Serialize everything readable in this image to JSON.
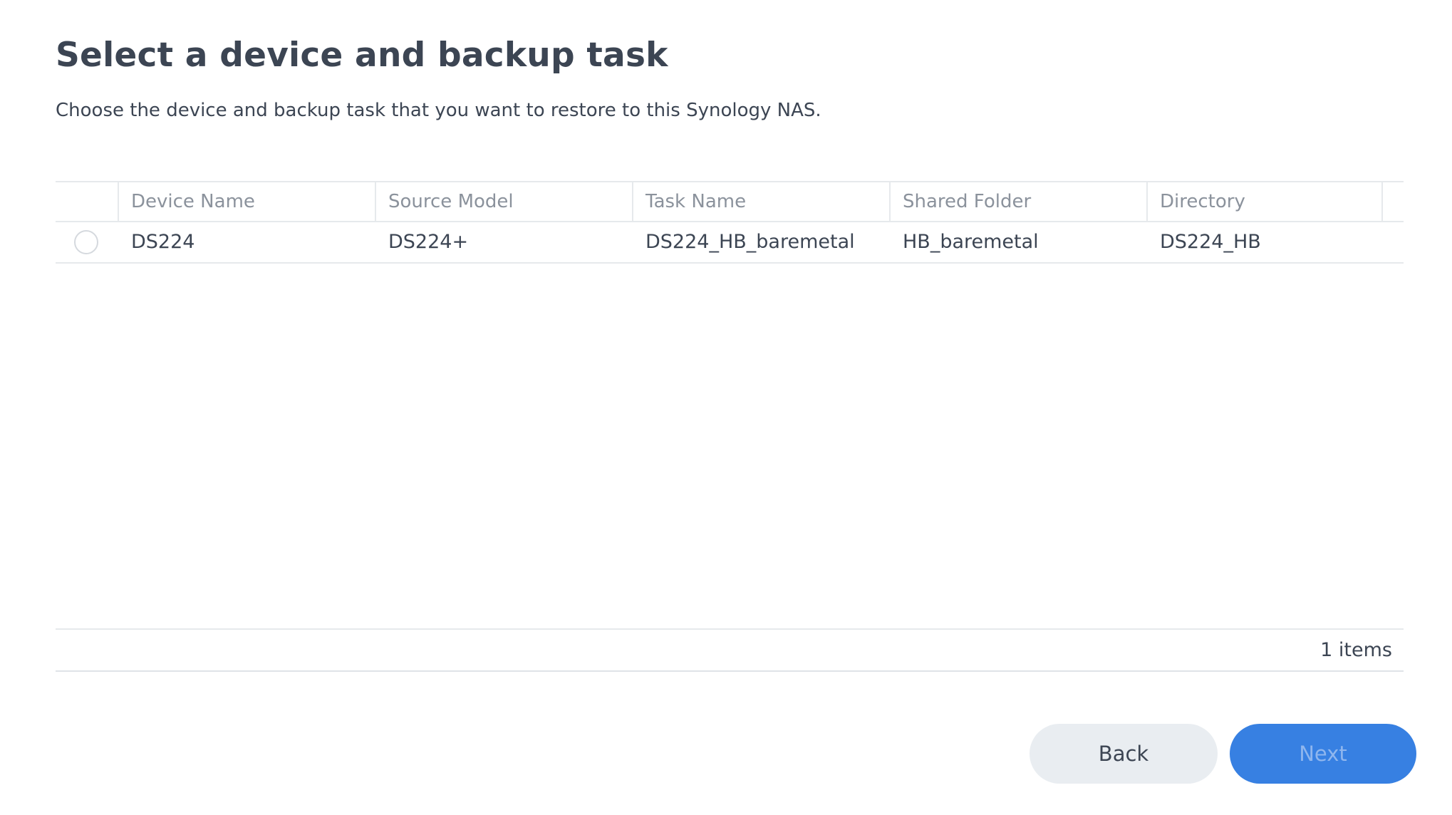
{
  "title": "Select a device and backup task",
  "subtitle": "Choose the device and backup task that you want to restore to this Synology NAS.",
  "table": {
    "columns": [
      "Device Name",
      "Source Model",
      "Task Name",
      "Shared Folder",
      "Directory"
    ],
    "rows": [
      {
        "selected": false,
        "device_name": "DS224",
        "source_model": "DS224+",
        "task_name": "DS224_HB_baremetal",
        "shared_folder": "HB_baremetal",
        "directory": "DS224_HB"
      }
    ],
    "item_count": "1 items"
  },
  "buttons": {
    "back_label": "Back",
    "next_label": "Next",
    "next_enabled": false
  },
  "colors": {
    "primary": "#3780e2",
    "text": "#3c4553",
    "muted_text": "#8b929c",
    "divider": "#e6e9ec",
    "secondary_button": "#e9edf1"
  }
}
